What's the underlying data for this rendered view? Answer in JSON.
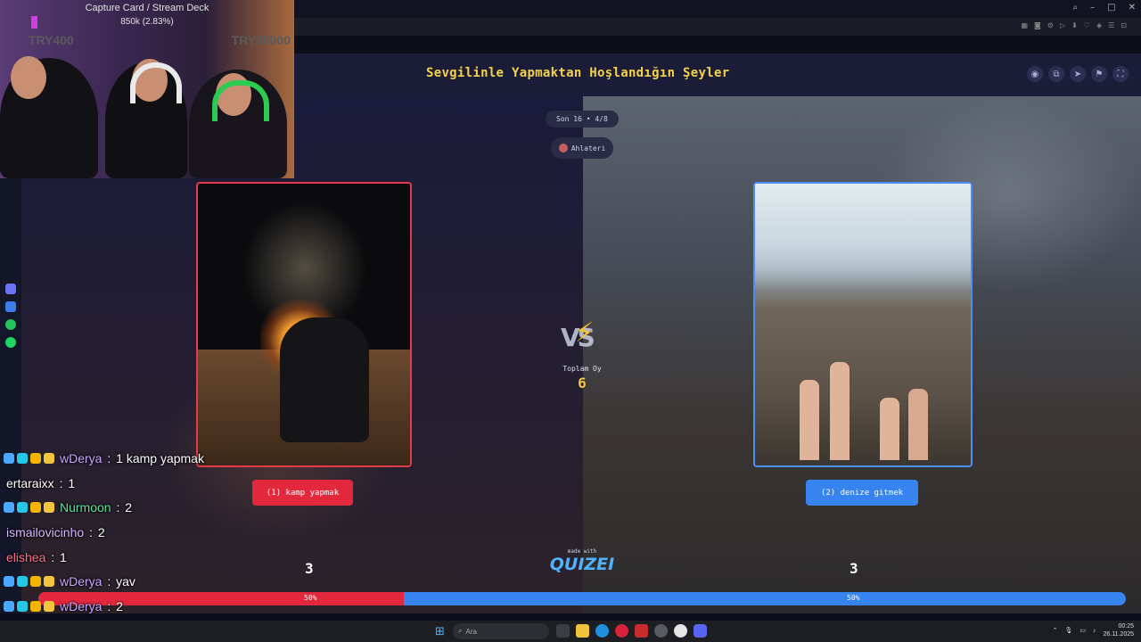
{
  "window": {
    "minimize": "–",
    "maximize": "□",
    "close": "✕"
  },
  "page": {
    "title": "Sevgilinle Yapmaktan Hoşlandığın Şeyler",
    "round_pill": "Son 16 • 4/8",
    "author": "Ahlateri"
  },
  "left_option": {
    "label": "(1) kamp yapmak",
    "votes": "3",
    "percent_text": "50%",
    "share": 0.5,
    "color": "#e3283e"
  },
  "right_option": {
    "label": "(2) denize gitmek",
    "votes": "3",
    "percent_text": "50%",
    "share": 0.5,
    "color": "#3783f0"
  },
  "center": {
    "vs": "VS",
    "total_label": "Toplam Oy",
    "total_value": "6",
    "made_with": "made with",
    "brand": "QUIZEI"
  },
  "overlay": {
    "capture_label": "Capture Card / Stream Deck",
    "capture_stat": "850k (2.83%)",
    "goal_left": "TRY400",
    "goal_right": "TRY30000"
  },
  "chat": [
    {
      "user": "wDerya",
      "message": "1 kamp yapmak",
      "color": "#c9a7ff",
      "badges": true
    },
    {
      "user": "ertaraixx",
      "message": "1",
      "color": "#ffffff",
      "badges": false
    },
    {
      "user": "Nurmoon",
      "message": "2",
      "color": "#5fe39a",
      "badges": true
    },
    {
      "user": "ismailovicinho",
      "message": "2",
      "color": "#d9b8ff",
      "badges": false
    },
    {
      "user": "elishea",
      "message": "1",
      "color": "#ff6f8a",
      "badges": false
    },
    {
      "user": "wDerya",
      "message": "yav",
      "color": "#c9a7ff",
      "badges": true
    },
    {
      "user": "wDerya",
      "message": "2",
      "color": "#c9a7ff",
      "badges": true
    }
  ],
  "taskbar": {
    "search_placeholder": "Ara",
    "time": "00:25",
    "date": "26.11.2025"
  }
}
